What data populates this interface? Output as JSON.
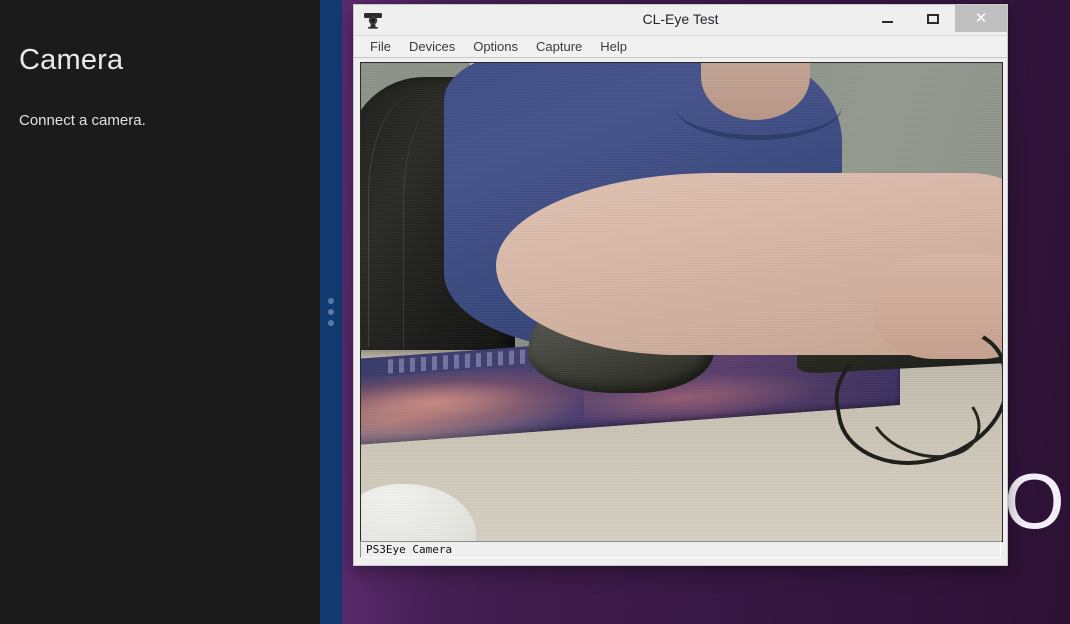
{
  "desktop": {
    "background_text": "ON",
    "purple_accent": "#3a1947",
    "splitter_color": "#123b73"
  },
  "camera_app": {
    "title": "Camera",
    "message": "Connect a camera.",
    "background": "#1b1b1b"
  },
  "splitter": {
    "handle_icon": "drag-handle-dots"
  },
  "cleye_window": {
    "icon": "webcam-icon",
    "title": "CL-Eye Test",
    "controls": {
      "minimize": "–",
      "maximize": "□",
      "close": "✕"
    },
    "menu": [
      {
        "label": "File"
      },
      {
        "label": "Devices"
      },
      {
        "label": "Options"
      },
      {
        "label": "Capture"
      },
      {
        "label": "Help"
      }
    ],
    "video": {
      "description": "Live webcam feed: person in blue shirt seated at desk with hand on mouse, mousepad, office chair and cables"
    },
    "status": {
      "text": "PS3Eye Camera"
    }
  }
}
